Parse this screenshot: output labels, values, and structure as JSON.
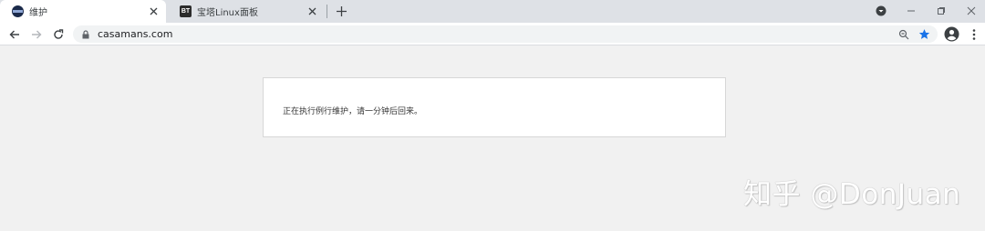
{
  "tabs": [
    {
      "title": "维护",
      "favicon": "globe-favicon",
      "active": true
    },
    {
      "title": "宝塔Linux面板",
      "favicon": "bt-favicon",
      "favicon_text": "BT",
      "active": false
    }
  ],
  "address_bar": {
    "url": "casamans.com"
  },
  "page": {
    "message": "正在执行例行维护，请一分钟后回来。"
  },
  "watermark": "知乎 @DonJuan",
  "colors": {
    "tabstrip": "#dee1e6",
    "bookmark_star": "#1a73e8",
    "page_bg": "#f1f1f1"
  }
}
